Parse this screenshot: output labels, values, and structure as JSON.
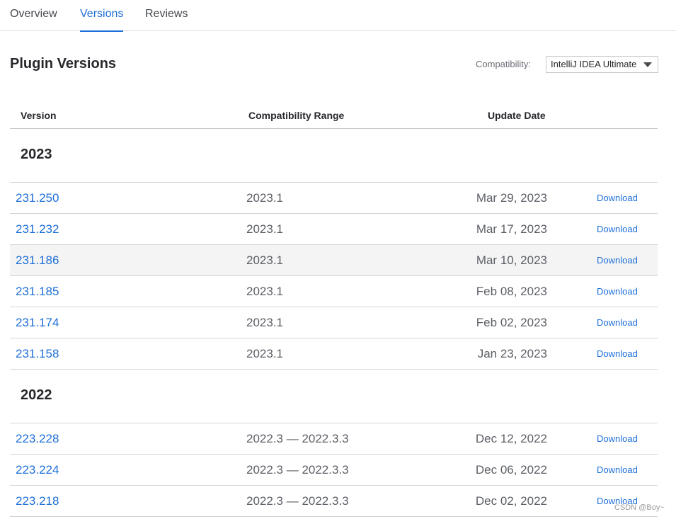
{
  "tabs": [
    {
      "label": "Overview"
    },
    {
      "label": "Versions",
      "active": true
    },
    {
      "label": "Reviews"
    }
  ],
  "page_title": "Plugin Versions",
  "compatibility": {
    "label": "Compatibility:",
    "selected": "IntelliJ IDEA Ultimate"
  },
  "table": {
    "headers": {
      "version": "Version",
      "range": "Compatibility Range",
      "date": "Update Date"
    },
    "groups": [
      {
        "year": "2023",
        "rows": [
          {
            "version": "231.250",
            "range": "2023.1",
            "date": "Mar 29, 2023",
            "action": "Download"
          },
          {
            "version": "231.232",
            "range": "2023.1",
            "date": "Mar 17, 2023",
            "action": "Download"
          },
          {
            "version": "231.186",
            "range": "2023.1",
            "date": "Mar 10, 2023",
            "action": "Download"
          },
          {
            "version": "231.185",
            "range": "2023.1",
            "date": "Feb 08, 2023",
            "action": "Download"
          },
          {
            "version": "231.174",
            "range": "2023.1",
            "date": "Feb 02, 2023",
            "action": "Download"
          },
          {
            "version": "231.158",
            "range": "2023.1",
            "date": "Jan 23, 2023",
            "action": "Download"
          }
        ]
      },
      {
        "year": "2022",
        "rows": [
          {
            "version": "223.228",
            "range": "2022.3 — 2022.3.3",
            "date": "Dec 12, 2022",
            "action": "Download"
          },
          {
            "version": "223.224",
            "range": "2022.3 — 2022.3.3",
            "date": "Dec 06, 2022",
            "action": "Download"
          },
          {
            "version": "223.218",
            "range": "2022.3 — 2022.3.3",
            "date": "Dec 02, 2022",
            "action": "Download"
          }
        ]
      }
    ]
  },
  "watermark": "CSDN @Boy~",
  "colors": {
    "accent": "#1e6fd9",
    "hover_row": "#f4f4f4",
    "text": "#27282c"
  }
}
